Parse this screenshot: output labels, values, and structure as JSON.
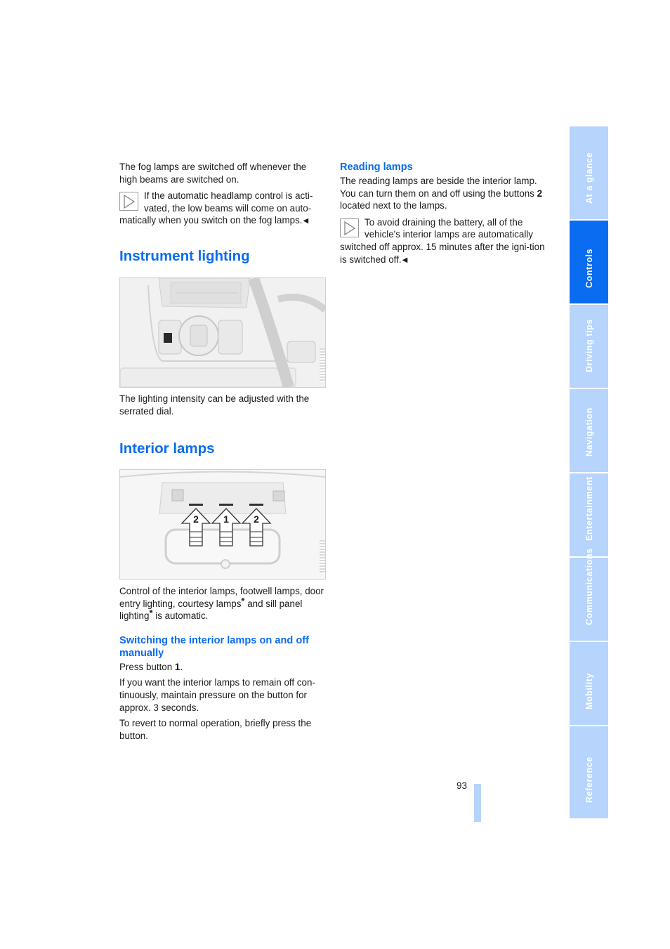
{
  "left_column": {
    "intro_paragraph": "The fog lamps are switched off whenever the high beams are switched on.",
    "fog_note": {
      "icon": "note-triangle-icon",
      "text": "If the automatic headlamp control is acti-vated, the low beams will come on auto-matically when you switch on the fog lamps.",
      "end_mark": "◀"
    },
    "instrument_lighting": {
      "heading": "Instrument lighting",
      "figure_alt": "Dashboard light switch with serrated dial next to steering wheel",
      "caption": "The lighting intensity can be adjusted with the serrated dial."
    },
    "interior_lamps": {
      "heading": "Interior lamps",
      "figure_alt": "Roof console above rear-view mirror with buttons",
      "figure_labels": [
        "2",
        "1",
        "2"
      ],
      "paragraph_parts": {
        "a": "Control of the interior lamps, footwell lamps, door entry lighting, courtesy lamps",
        "b": " and sill panel lighting",
        "c": " is automatic.",
        "star": "*"
      },
      "subheading": "Switching the interior lamps on and off manually",
      "press_button": {
        "prefix": "Press button ",
        "button_number": "1",
        "suffix": "."
      },
      "paragraph_hold": "If you want the interior lamps to remain off con-tinuously, maintain pressure on the button for approx. 3 seconds.",
      "paragraph_revert": "To revert to normal operation, briefly press the button."
    }
  },
  "right_column": {
    "reading_lamps": {
      "heading": "Reading lamps",
      "paragraph_parts": {
        "a": "The reading lamps are beside the interior lamp. You can turn them on and off using the buttons ",
        "button_number": "2",
        "b": " located next to the lamps."
      },
      "battery_note": {
        "icon": "note-triangle-icon",
        "text": "To avoid draining the battery, all of the vehicle's interior lamps are automatically switched off approx. 15 minutes after the igni-tion is switched off.",
        "end_mark": "◀"
      }
    }
  },
  "side_tabs": [
    {
      "label": "At a glance",
      "active": false
    },
    {
      "label": "Controls",
      "active": true
    },
    {
      "label": "Driving tips",
      "active": false
    },
    {
      "label": "Navigation",
      "active": false
    },
    {
      "label": "Entertainment",
      "active": false
    },
    {
      "label": "Communications",
      "active": false
    },
    {
      "label": "Mobility",
      "active": false
    },
    {
      "label": "Reference",
      "active": false
    }
  ],
  "page_number": "93",
  "colors": {
    "heading_blue": "#0a6cf0",
    "tab_inactive": "#b6d4fc",
    "tab_active": "#0a6cf0",
    "body_text": "#1a1a1a"
  }
}
